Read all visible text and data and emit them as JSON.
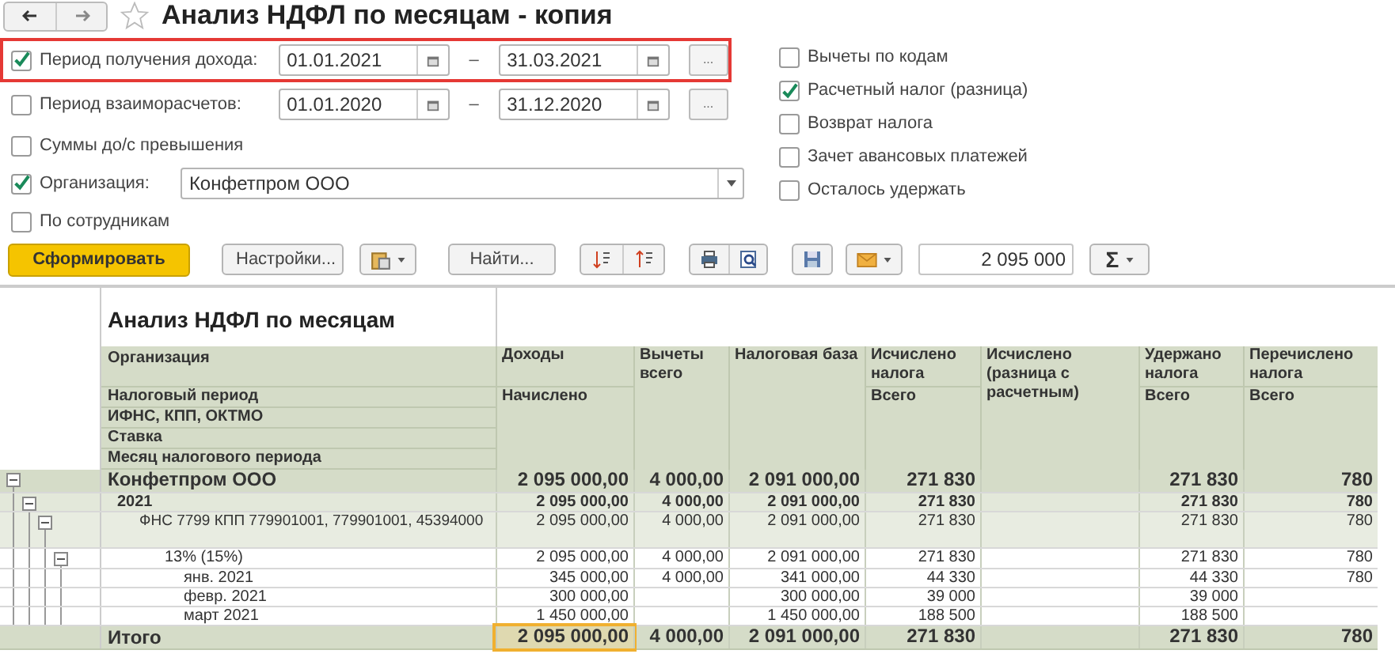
{
  "window": {
    "title": "Анализ НДФЛ по месяцам - копия"
  },
  "filters": {
    "periods": [
      {
        "label": "Период получения дохода:",
        "checked": true,
        "highlighted": true,
        "from": "01.01.2021",
        "to": "31.03.2021",
        "dash": "–",
        "more": "..."
      },
      {
        "label": "Период взаиморасчетов:",
        "checked": false,
        "highlighted": false,
        "from": "01.01.2020",
        "to": "31.12.2020",
        "dash": "–",
        "more": "..."
      }
    ],
    "excess": {
      "label": "Суммы до/с превышения",
      "checked": false
    },
    "organization": {
      "label": "Организация:",
      "checked": true,
      "value": "Конфетпром ООО"
    },
    "by_employees": {
      "label": "По сотрудникам",
      "checked": false
    },
    "options": [
      {
        "label": "Вычеты по кодам",
        "checked": false
      },
      {
        "label": "Расчетный налог (разница)",
        "checked": true
      },
      {
        "label": "Возврат налога",
        "checked": false
      },
      {
        "label": "Зачет авансовых платежей",
        "checked": false
      },
      {
        "label": "Осталось удержать",
        "checked": false
      }
    ]
  },
  "toolbar": {
    "generate": "Сформировать",
    "settings": "Настройки...",
    "find": "Найти...",
    "sum_value": "2 095 000",
    "sum_button": "Σ"
  },
  "report": {
    "title": "Анализ НДФЛ по месяцам",
    "row_headers": [
      "Организация",
      "Налоговый период",
      "ИФНС, КПП, ОКТМО",
      "Ставка",
      "Месяц налогового периода"
    ],
    "columns": [
      {
        "title": "Доходы",
        "sub": "Начислено"
      },
      {
        "title": "Вычеты всего"
      },
      {
        "title": "Налоговая база"
      },
      {
        "title": "Исчислено налога",
        "sub": "Всего"
      },
      {
        "title": "Исчислено (разница с расчетным)"
      },
      {
        "title": "Удержано налога",
        "sub": "Всего"
      },
      {
        "title": "Перечислено налога",
        "sub": "Всего"
      }
    ],
    "rows": [
      {
        "label": "Конфетпром ООО",
        "expanded": true,
        "values": {
          "income": "2 095 000,00",
          "deductions": "4 000,00",
          "tax_base": "2 091 000,00",
          "tax_calculated": "271 830",
          "tax_withheld": "271 830",
          "tax_transferred": "780"
        },
        "children": [
          {
            "label": "2021",
            "expanded": true,
            "values": {
              "income": "2 095 000,00",
              "deductions": "4 000,00",
              "tax_base": "2 091 000,00",
              "tax_calculated": "271 830",
              "tax_withheld": "271 830",
              "tax_transferred": "780"
            },
            "children": [
              {
                "label": "ФНС 7799 КПП 779901001, 779901001, 45394000",
                "expanded": true,
                "values": {
                  "income": "2 095 000,00",
                  "deductions": "4 000,00",
                  "tax_base": "2 091 000,00",
                  "tax_calculated": "271 830",
                  "tax_withheld": "271 830",
                  "tax_transferred": "780"
                },
                "children": [
                  {
                    "label": "13% (15%)",
                    "expanded": true,
                    "values": {
                      "income": "2 095 000,00",
                      "deductions": "4 000,00",
                      "tax_base": "2 091 000,00",
                      "tax_calculated": "271 830",
                      "tax_withheld": "271 830",
                      "tax_transferred": "780"
                    },
                    "children": [
                      {
                        "label": "янв. 2021",
                        "values": {
                          "income": "345 000,00",
                          "deductions": "4 000,00",
                          "tax_base": "341 000,00",
                          "tax_calculated": "44 330",
                          "tax_withheld": "44 330",
                          "tax_transferred": "780"
                        }
                      },
                      {
                        "label": "февр. 2021",
                        "values": {
                          "income": "300 000,00",
                          "tax_base": "300 000,00",
                          "tax_calculated": "39 000",
                          "tax_withheld": "39 000"
                        }
                      },
                      {
                        "label": "март 2021",
                        "values": {
                          "income": "1 450 000,00",
                          "tax_base": "1 450 000,00",
                          "tax_calculated": "188 500",
                          "tax_withheld": "188 500"
                        }
                      }
                    ]
                  }
                ]
              }
            ]
          }
        ]
      }
    ],
    "total": {
      "label": "Итого",
      "values": {
        "income": {
          "text": "2 095 000,00",
          "selected": true
        },
        "deductions": {
          "text": "4 000,00",
          "selected": false
        },
        "tax_base": {
          "text": "2 091 000,00",
          "selected": false
        },
        "tax_calculated": {
          "text": "271 830",
          "selected": false
        },
        "tax_withheld": {
          "text": "271 830",
          "selected": false
        },
        "tax_transferred": {
          "text": "780",
          "selected": false
        }
      }
    }
  }
}
